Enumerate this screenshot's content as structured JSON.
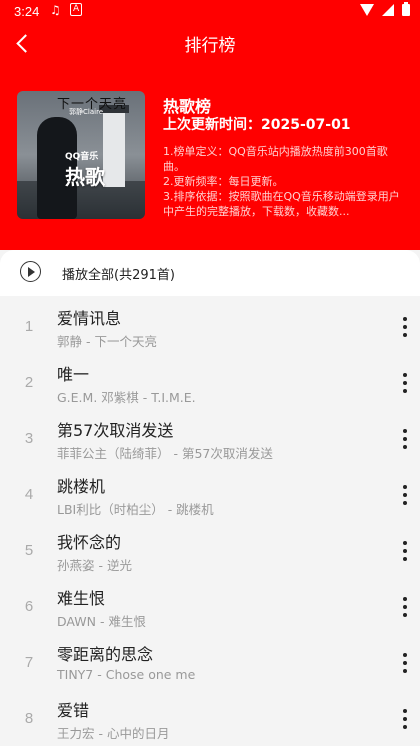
{
  "status": {
    "time": "3:24",
    "icon1": "♫",
    "icon2": "A"
  },
  "header": {
    "title": "排行榜",
    "chart_name": "热歌榜",
    "last_update": "上次更新时间：2025-07-01",
    "desc": [
      "1.榜单定义：QQ音乐站内播放热度前300首歌曲。",
      "2.更新频率：每日更新。",
      "3.排序依据：按照歌曲在QQ音乐移动端登录用户中产生的完整播放，下载数，收藏数..."
    ],
    "cover": {
      "top_text": "下一个天亮",
      "small_text": "郭静Claire",
      "qq_text": "QQ音乐",
      "hot_text": "热歌"
    }
  },
  "playall": {
    "label": "播放全部(共291首)"
  },
  "songs": [
    {
      "rank": "1",
      "title": "爱情讯息",
      "artist": "郭静 - 下一个天亮"
    },
    {
      "rank": "2",
      "title": "唯一",
      "artist": "G.E.M. 邓紫棋 - T.I.M.E."
    },
    {
      "rank": "3",
      "title": "第57次取消发送",
      "artist": "菲菲公主（陆绮菲） - 第57次取消发送"
    },
    {
      "rank": "4",
      "title": "跳楼机",
      "artist": "LBI利比（时柏尘） - 跳楼机"
    },
    {
      "rank": "5",
      "title": "我怀念的",
      "artist": "孙燕姿 - 逆光"
    },
    {
      "rank": "6",
      "title": "难生恨",
      "artist": "DAWN - 难生恨"
    },
    {
      "rank": "7",
      "title": "零距离的思念",
      "artist": "TINY7 - Chose one me"
    },
    {
      "rank": "8",
      "title": "爱错",
      "artist": "王力宏 - 心中的日月"
    }
  ],
  "colors": {
    "accent": "#ff0000"
  }
}
